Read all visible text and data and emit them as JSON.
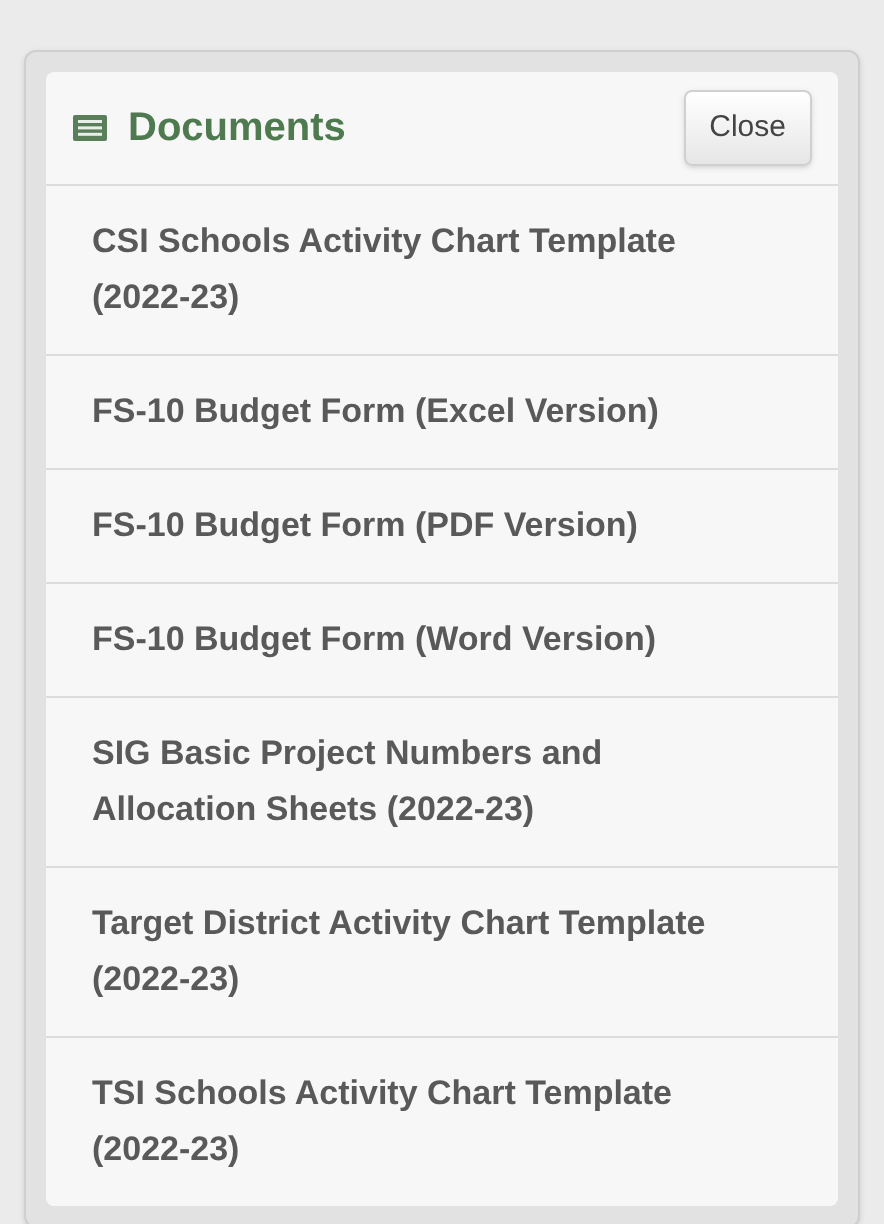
{
  "panel": {
    "title": "Documents",
    "close_button": "Close"
  },
  "documents": [
    {
      "name": "CSI Schools Activity Chart Template (2022-23)"
    },
    {
      "name": "FS-10 Budget Form (Excel Version)"
    },
    {
      "name": "FS-10 Budget Form (PDF Version)"
    },
    {
      "name": "FS-10 Budget Form (Word Version)"
    },
    {
      "name": "SIG Basic Project Numbers and Allocation Sheets (2022-23)"
    },
    {
      "name": "Target District Activity Chart Template (2022-23)"
    },
    {
      "name": "TSI Schools Activity Chart Template (2022-23)"
    }
  ]
}
